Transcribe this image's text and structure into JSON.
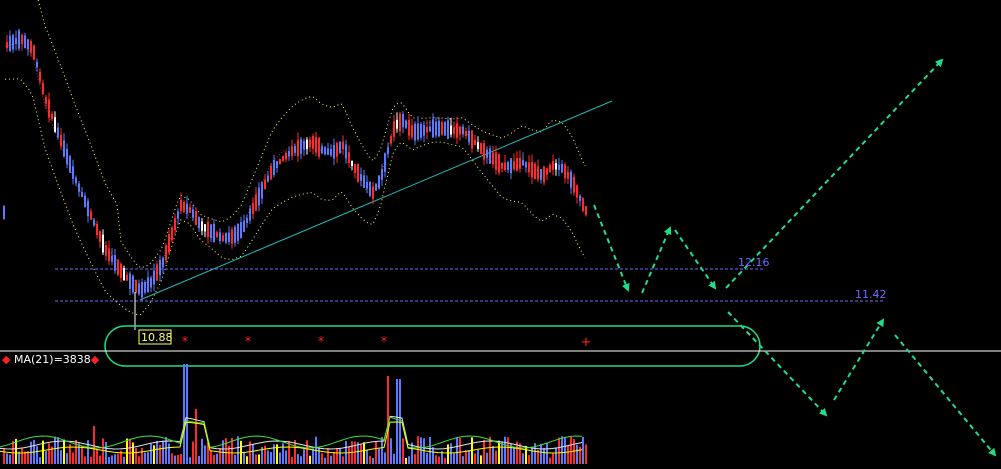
{
  "colors": {
    "background": "#000000",
    "up_candle": "#ff2a2a",
    "down_candle": "#5a7bff",
    "neutral_candle": "#ffffff",
    "bollinger": "#ffff66",
    "trendline": "#22b8b8",
    "support": "#6a6aff",
    "projection": "#22dd88",
    "marker": "#ff2020",
    "volume_ma_white": "#e6e6e6",
    "volume_ma_green": "#40e040",
    "volume_ma_yellow": "#ffff00",
    "low_box": "#ffff66"
  },
  "chart_data": {
    "type": "candlestick",
    "title": "",
    "price_levels": [
      {
        "name": "resistance",
        "value": 12.16,
        "label": "12.16"
      },
      {
        "name": "support",
        "value": 11.42,
        "label": "11.42"
      }
    ],
    "low_marker": {
      "value": 10.88,
      "label": "10.88"
    },
    "volume_indicator_label": "MA(21)=3838",
    "volume_indicator_markers": [
      "◆",
      "◆"
    ],
    "star_markers": [
      "*",
      "*",
      "*",
      "*",
      "+"
    ],
    "overlays": [
      "bollinger_bands",
      "trendline",
      "forecast_arrows"
    ],
    "price_range": [
      10.6,
      15.4
    ],
    "volume_range": [
      0,
      10000
    ]
  }
}
